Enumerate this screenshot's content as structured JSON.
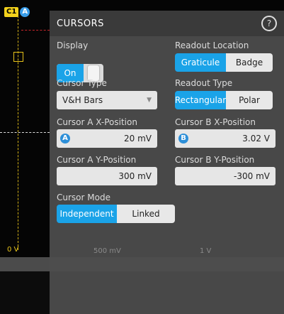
{
  "scope": {
    "channel_badge": "C1",
    "cursor_badge": "A",
    "zero_label": "0 V",
    "scale_left": "500 mV",
    "scale_right": "1 V",
    "ch_color": "#f3d21c",
    "cursor_color": "#3a9de8"
  },
  "panel": {
    "title": "CURSORS",
    "help_icon": "?",
    "display": {
      "label": "Display",
      "value": "On"
    },
    "readout_location": {
      "label": "Readout Location",
      "options": [
        "Graticule",
        "Badge"
      ],
      "selected": "Graticule"
    },
    "cursor_type": {
      "label": "Cursor Type",
      "value": "V&H Bars"
    },
    "readout_type": {
      "label": "Readout Type",
      "options": [
        "Rectangular",
        "Polar"
      ],
      "selected": "Rectangular"
    },
    "cursor_a_x": {
      "label": "Cursor A X-Position",
      "badge": "A",
      "value": "20 mV"
    },
    "cursor_b_x": {
      "label": "Cursor B X-Position",
      "badge": "B",
      "value": "3.02 V"
    },
    "cursor_a_y": {
      "label": "Cursor A Y-Position",
      "value": "300 mV"
    },
    "cursor_b_y": {
      "label": "Cursor B Y-Position",
      "value": "-300 mV"
    },
    "cursor_mode": {
      "label": "Cursor Mode",
      "options": [
        "Independent",
        "Linked"
      ],
      "selected": "Independent"
    },
    "accent": "#1aa3e8"
  }
}
